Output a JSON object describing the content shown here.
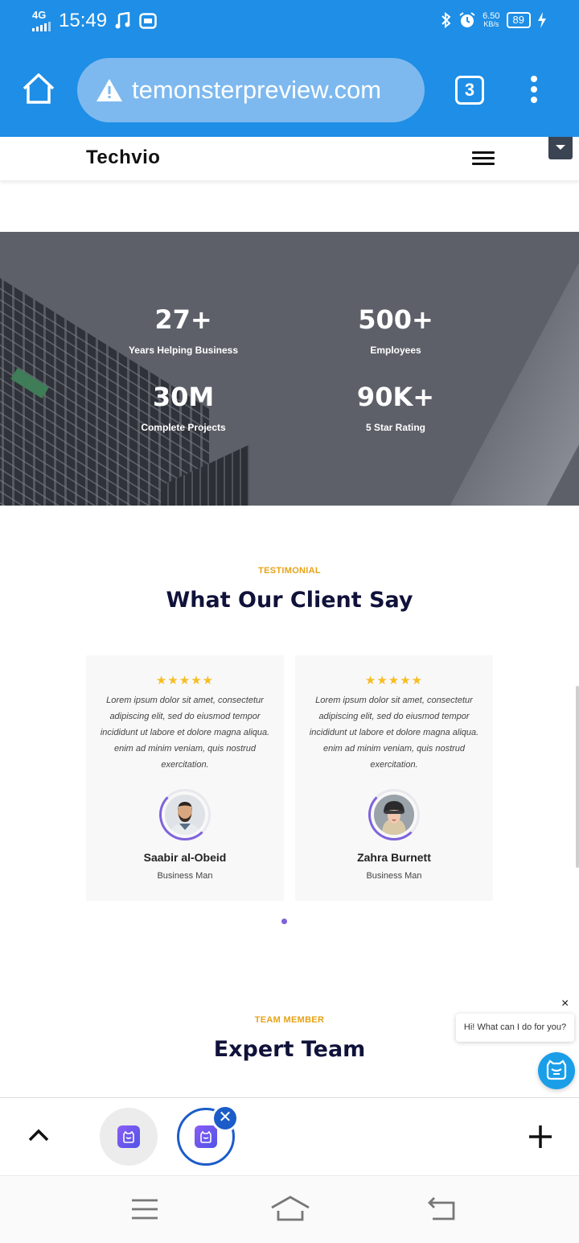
{
  "status_bar": {
    "network": "4G",
    "time": "15:49",
    "speed_value": "6.50",
    "speed_unit": "KB/s",
    "battery": "89"
  },
  "browser": {
    "url": "temonsterpreview.com",
    "tab_count": "3"
  },
  "site": {
    "logo": "Techvio"
  },
  "stats": [
    {
      "value": "27+",
      "label": "Years Helping Business"
    },
    {
      "value": "500+",
      "label": "Employees"
    },
    {
      "value": "30M",
      "label": "Complete Projects"
    },
    {
      "value": "90K+",
      "label": "5 Star Rating"
    }
  ],
  "testimonial": {
    "eyebrow": "TESTIMONIAL",
    "title": "What Our Client Say",
    "cards": [
      {
        "stars": "★★★★★",
        "rating": 5,
        "quote": "Lorem ipsum dolor sit amet, consectetur adipiscing elit, sed do eiusmod tempor incididunt ut labore et dolore magna aliqua. enim ad minim veniam, quis nostrud exercitation.",
        "name": "Saabir al-Obeid",
        "role": "Business Man"
      },
      {
        "stars": "★★★★★",
        "rating": 5,
        "quote": "Lorem ipsum dolor sit amet, consectetur adipiscing elit, sed do eiusmod tempor incididunt ut labore et dolore magna aliqua. enim ad minim veniam, quis nostrud exercitation.",
        "name": "Zahra Burnett",
        "role": "Business Man"
      }
    ]
  },
  "team": {
    "eyebrow": "TEAM MEMBER",
    "title": "Expert Team"
  },
  "chat": {
    "close": "×",
    "message": "Hi! What can I do for you?"
  },
  "tab_strip": {
    "close_symbol": "✕"
  },
  "colors": {
    "browser_blue": "#1e8ee6",
    "accent_purple": "#7e63db",
    "eyebrow_orange": "#e6a317",
    "star_yellow": "#f7bd23",
    "title_navy": "#10123a"
  }
}
